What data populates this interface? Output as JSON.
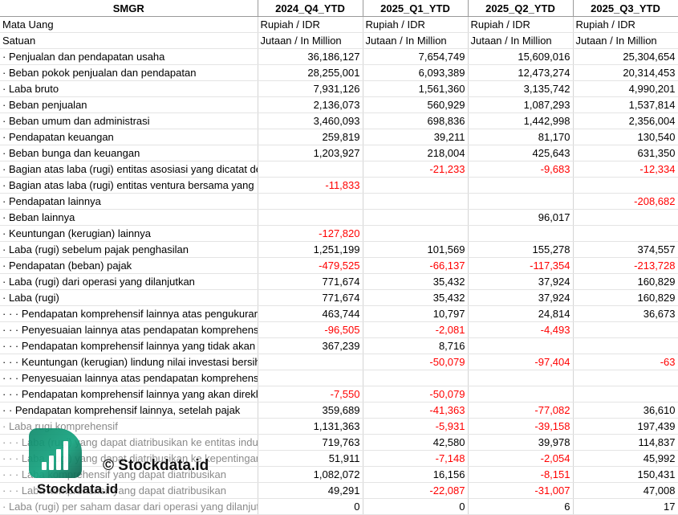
{
  "header": {
    "ticker": "SMGR",
    "periods": [
      "2024_Q4_YTD",
      "2025_Q1_YTD",
      "2025_Q2_YTD",
      "2025_Q3_YTD"
    ]
  },
  "meta": [
    {
      "label": "Mata Uang",
      "values": [
        "Rupiah / IDR",
        "Rupiah / IDR",
        "Rupiah / IDR",
        "Rupiah / IDR"
      ]
    },
    {
      "label": "Satuan",
      "values": [
        "Jutaan / In Million",
        "Jutaan / In Million",
        "Jutaan / In Million",
        "Jutaan / In Million"
      ]
    }
  ],
  "rows": [
    {
      "label": "· Penjualan dan pendapatan usaha",
      "values": [
        "36,186,127",
        "7,654,749",
        "15,609,016",
        "25,304,654"
      ]
    },
    {
      "label": "· Beban pokok penjualan dan pendapatan",
      "values": [
        "28,255,001",
        "6,093,389",
        "12,473,274",
        "20,314,453"
      ]
    },
    {
      "label": "· Laba bruto",
      "values": [
        "7,931,126",
        "1,561,360",
        "3,135,742",
        "4,990,201"
      ]
    },
    {
      "label": "· Beban penjualan",
      "values": [
        "2,136,073",
        "560,929",
        "1,087,293",
        "1,537,814"
      ]
    },
    {
      "label": "· Beban umum dan administrasi",
      "values": [
        "3,460,093",
        "698,836",
        "1,442,998",
        "2,356,004"
      ]
    },
    {
      "label": "· Pendapatan keuangan",
      "values": [
        "259,819",
        "39,211",
        "81,170",
        "130,540"
      ]
    },
    {
      "label": "· Beban bunga dan keuangan",
      "values": [
        "1,203,927",
        "218,004",
        "425,643",
        "631,350"
      ]
    },
    {
      "label": "· Bagian atas laba (rugi) entitas asosiasi yang dicatat dengan menggunakan",
      "values": [
        "",
        "-21,233",
        "-9,683",
        "-12,334"
      ],
      "spill": true
    },
    {
      "label": "· Bagian atas laba (rugi) entitas ventura bersama yang",
      "values": [
        "-11,833",
        "",
        "",
        ""
      ]
    },
    {
      "label": "· Pendapatan lainnya",
      "values": [
        "",
        "",
        "",
        "-208,682"
      ]
    },
    {
      "label": "· Beban lainnya",
      "values": [
        "",
        "",
        "96,017",
        ""
      ]
    },
    {
      "label": "· Keuntungan (kerugian) lainnya",
      "values": [
        "-127,820",
        "",
        "",
        ""
      ]
    },
    {
      "label": "· Laba (rugi) sebelum pajak penghasilan",
      "values": [
        "1,251,199",
        "101,569",
        "155,278",
        "374,557"
      ]
    },
    {
      "label": "· Pendapatan (beban) pajak",
      "values": [
        "-479,525",
        "-66,137",
        "-117,354",
        "-213,728"
      ]
    },
    {
      "label": "· Laba (rugi) dari operasi yang dilanjutkan",
      "values": [
        "771,674",
        "35,432",
        "37,924",
        "160,829"
      ]
    },
    {
      "label": "· Laba (rugi)",
      "values": [
        "771,674",
        "35,432",
        "37,924",
        "160,829"
      ]
    },
    {
      "label": "· · · Pendapatan komprehensif lainnya atas pengukuran",
      "values": [
        "463,744",
        "10,797",
        "24,814",
        "36,673"
      ]
    },
    {
      "label": "· · · Penyesuaian lainnya atas pendapatan komprehensif",
      "values": [
        "-96,505",
        "-2,081",
        "-4,493",
        ""
      ]
    },
    {
      "label": "· · · Pendapatan komprehensif lainnya yang tidak akan",
      "values": [
        "367,239",
        "8,716",
        "",
        ""
      ]
    },
    {
      "label": "· · · Keuntungan (kerugian) lindung nilai investasi bersih kegiatan usaha luar negeri",
      "values": [
        "",
        "-50,079",
        "-97,404",
        "-63"
      ]
    },
    {
      "label": "· · · Penyesuaian lainnya atas pendapatan komprehensif lainnya yang akan direklasifikasi ke laba rugi, setelah pajak",
      "values": [
        "",
        "",
        "",
        ""
      ],
      "spill": true
    },
    {
      "label": "· · · Pendapatan komprehensif lainnya yang akan direklasifikasi",
      "values": [
        "-7,550",
        "-50,079",
        "",
        ""
      ]
    },
    {
      "label": "· · Pendapatan komprehensif lainnya, setelah pajak",
      "values": [
        "359,689",
        "-41,363",
        "-77,082",
        "36,610"
      ]
    },
    {
      "label": "· Laba rugi komprehensif",
      "values": [
        "1,131,363",
        "-5,931",
        "-39,158",
        "197,439"
      ],
      "faded": true
    },
    {
      "label": "· · · Laba (rugi) yang dapat diatribusikan ke entitas induk",
      "values": [
        "719,763",
        "42,580",
        "39,978",
        "114,837"
      ],
      "faded": true
    },
    {
      "label": "· · · Laba (rugi) yang dapat diatribusikan ke kepentingan",
      "values": [
        "51,911",
        "-7,148",
        "-2,054",
        "45,992"
      ],
      "faded": true
    },
    {
      "label": "· · · Laba komprehensif yang dapat diatribusikan",
      "values": [
        "1,082,072",
        "16,156",
        "-8,151",
        "150,431"
      ],
      "faded": true
    },
    {
      "label": "· · · Laba komprehensif yang dapat diatribusikan",
      "values": [
        "49,291",
        "-22,087",
        "-31,007",
        "47,008"
      ],
      "faded": true
    },
    {
      "label": "· Laba (rugi) per saham dasar dari operasi yang dilanjutkan",
      "values": [
        "0",
        "0",
        "6",
        "17"
      ],
      "faded": true
    }
  ],
  "watermark": {
    "copyright": "© Stockdata.id",
    "brand": "Stockdata.id",
    "logo_icon": "bar-chart-logo-icon",
    "logo_color": "#13a37e"
  }
}
